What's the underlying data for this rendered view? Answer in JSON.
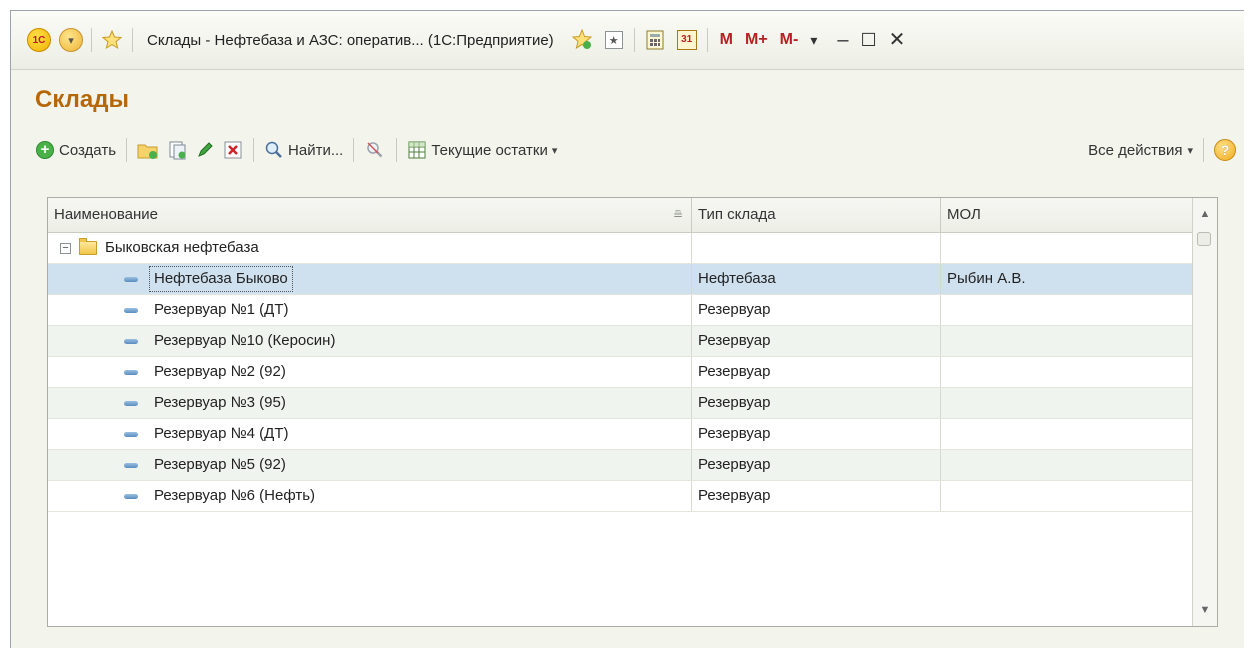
{
  "titlebar": {
    "logo": "1С",
    "title": "Склады - Нефтебаза и АЗС: оператив...  (1С:Предприятие)",
    "m_buttons": [
      "M",
      "M+",
      "M-"
    ],
    "icons": [
      "menu-icon",
      "star-icon",
      "favorites-add-icon",
      "history-icon",
      "calculator-icon",
      "calendar-icon"
    ],
    "calendar_day": "31"
  },
  "page": {
    "title": "Склады"
  },
  "toolbar": {
    "create_label": "Создать",
    "find_label": "Найти...",
    "stock_label": "Текущие остатки",
    "all_actions_label": "Все действия",
    "help_label": "?"
  },
  "table": {
    "columns": [
      "Наименование",
      "Тип склада",
      "МОЛ"
    ],
    "group": {
      "name": "Быковская нефтебаза",
      "type": "",
      "mol": ""
    },
    "rows": [
      {
        "name": "Нефтебаза Быково",
        "type": "Нефтебаза",
        "mol": "Рыбин А.В.",
        "selected": true
      },
      {
        "name": "Резервуар №1 (ДТ)",
        "type": "Резервуар",
        "mol": ""
      },
      {
        "name": "Резервуар №10 (Керосин)",
        "type": "Резервуар",
        "mol": ""
      },
      {
        "name": "Резервуар №2 (92)",
        "type": "Резервуар",
        "mol": ""
      },
      {
        "name": "Резервуар №3 (95)",
        "type": "Резервуар",
        "mol": ""
      },
      {
        "name": "Резервуар №4 (ДТ)",
        "type": "Резервуар",
        "mol": ""
      },
      {
        "name": "Резервуар №5 (92)",
        "type": "Резервуар",
        "mol": ""
      },
      {
        "name": "Резервуар №6 (Нефть)",
        "type": "Резервуар",
        "mol": ""
      }
    ]
  },
  "colors": {
    "accent_title": "#b4680a",
    "selected_row": "#cfe0ef",
    "alt_row": "#f0f4ee"
  }
}
